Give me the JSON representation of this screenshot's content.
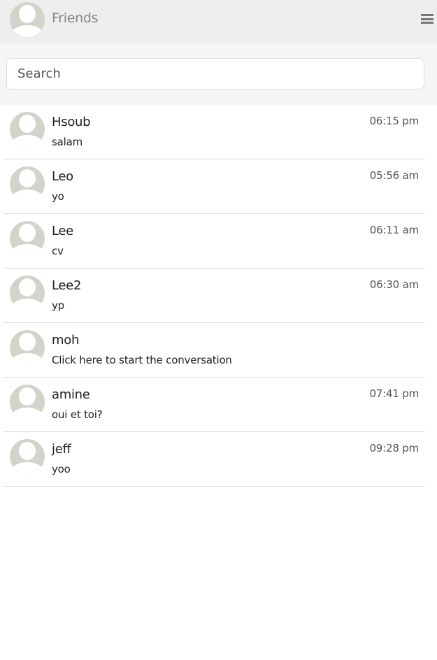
{
  "header": {
    "title": "Friends",
    "menu_icon": "hamburger-icon"
  },
  "search": {
    "placeholder": "Search",
    "value": ""
  },
  "friends": [
    {
      "name": "Hsoub",
      "message": "salam",
      "time": "06:15 pm"
    },
    {
      "name": "Leo",
      "message": "yo",
      "time": "05:56 am"
    },
    {
      "name": "Lee",
      "message": "cv",
      "time": "06:11 am"
    },
    {
      "name": "Lee2",
      "message": "yp",
      "time": "06:30 am"
    },
    {
      "name": "moh",
      "message": "Click here to start the conversation",
      "time": ""
    },
    {
      "name": "amine",
      "message": "oui et toi?",
      "time": "07:41 pm"
    },
    {
      "name": "jeff",
      "message": "yoo",
      "time": "09:28 pm"
    }
  ],
  "colors": {
    "header_bg": "#eeeeee",
    "avatar_bg": "#d3d2cb"
  }
}
